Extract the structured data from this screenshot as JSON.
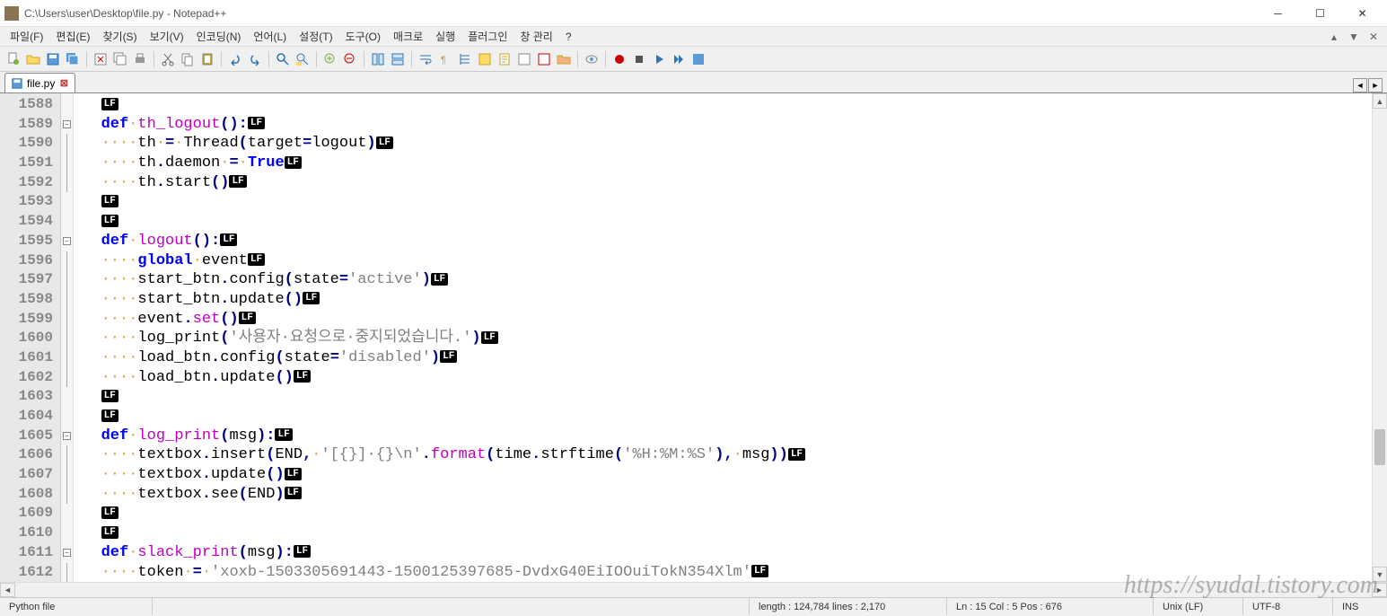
{
  "title": "C:\\Users\\user\\Desktop\\file.py - Notepad++",
  "menu": [
    "파일(F)",
    "편집(E)",
    "찾기(S)",
    "보기(V)",
    "인코딩(N)",
    "언어(L)",
    "설정(T)",
    "도구(O)",
    "매크로",
    "실행",
    "플러그인",
    "창 관리",
    "?"
  ],
  "tab": {
    "name": "file.py"
  },
  "line_start": 1588,
  "line_end": 1612,
  "code": [
    {
      "fold": "",
      "tokens": [
        {
          "t": "lf"
        }
      ]
    },
    {
      "fold": "box",
      "tokens": [
        {
          "t": "kw",
          "v": "def"
        },
        {
          "t": "ws",
          "v": "·"
        },
        {
          "t": "fn",
          "v": "th_logout"
        },
        {
          "t": "op",
          "v": "():"
        },
        {
          "t": "lf"
        }
      ]
    },
    {
      "fold": "line",
      "tokens": [
        {
          "t": "ws",
          "v": "····"
        },
        {
          "t": "txt",
          "v": "th"
        },
        {
          "t": "ws",
          "v": "·"
        },
        {
          "t": "op",
          "v": "="
        },
        {
          "t": "ws",
          "v": "·"
        },
        {
          "t": "txt",
          "v": "Thread"
        },
        {
          "t": "op",
          "v": "("
        },
        {
          "t": "txt",
          "v": "target"
        },
        {
          "t": "op",
          "v": "="
        },
        {
          "t": "txt",
          "v": "logout"
        },
        {
          "t": "op",
          "v": ")"
        },
        {
          "t": "lf"
        }
      ]
    },
    {
      "fold": "line",
      "tokens": [
        {
          "t": "ws",
          "v": "····"
        },
        {
          "t": "txt",
          "v": "th"
        },
        {
          "t": "op",
          "v": "."
        },
        {
          "t": "txt",
          "v": "daemon"
        },
        {
          "t": "ws",
          "v": "·"
        },
        {
          "t": "op",
          "v": "="
        },
        {
          "t": "ws",
          "v": "·"
        },
        {
          "t": "bool",
          "v": "True"
        },
        {
          "t": "lf"
        }
      ]
    },
    {
      "fold": "line",
      "tokens": [
        {
          "t": "ws",
          "v": "····"
        },
        {
          "t": "txt",
          "v": "th"
        },
        {
          "t": "op",
          "v": "."
        },
        {
          "t": "txt",
          "v": "start"
        },
        {
          "t": "op",
          "v": "()"
        },
        {
          "t": "lf"
        }
      ]
    },
    {
      "fold": "",
      "tokens": [
        {
          "t": "lf"
        }
      ]
    },
    {
      "fold": "",
      "tokens": [
        {
          "t": "lf"
        }
      ]
    },
    {
      "fold": "box",
      "tokens": [
        {
          "t": "kw",
          "v": "def"
        },
        {
          "t": "ws",
          "v": "·"
        },
        {
          "t": "fn",
          "v": "logout"
        },
        {
          "t": "op",
          "v": "():"
        },
        {
          "t": "lf"
        }
      ]
    },
    {
      "fold": "line",
      "tokens": [
        {
          "t": "ws",
          "v": "····"
        },
        {
          "t": "kw",
          "v": "global"
        },
        {
          "t": "ws",
          "v": "·"
        },
        {
          "t": "txt",
          "v": "event"
        },
        {
          "t": "lf"
        }
      ]
    },
    {
      "fold": "line",
      "tokens": [
        {
          "t": "ws",
          "v": "····"
        },
        {
          "t": "txt",
          "v": "start_btn"
        },
        {
          "t": "op",
          "v": "."
        },
        {
          "t": "txt",
          "v": "config"
        },
        {
          "t": "op",
          "v": "("
        },
        {
          "t": "txt",
          "v": "state"
        },
        {
          "t": "op",
          "v": "="
        },
        {
          "t": "str",
          "v": "'active'"
        },
        {
          "t": "op",
          "v": ")"
        },
        {
          "t": "lf"
        }
      ]
    },
    {
      "fold": "line",
      "tokens": [
        {
          "t": "ws",
          "v": "····"
        },
        {
          "t": "txt",
          "v": "start_btn"
        },
        {
          "t": "op",
          "v": "."
        },
        {
          "t": "txt",
          "v": "update"
        },
        {
          "t": "op",
          "v": "()"
        },
        {
          "t": "lf"
        }
      ]
    },
    {
      "fold": "line",
      "tokens": [
        {
          "t": "ws",
          "v": "····"
        },
        {
          "t": "txt",
          "v": "event"
        },
        {
          "t": "op",
          "v": "."
        },
        {
          "t": "fn",
          "v": "set"
        },
        {
          "t": "op",
          "v": "()"
        },
        {
          "t": "lf"
        }
      ]
    },
    {
      "fold": "line",
      "tokens": [
        {
          "t": "ws",
          "v": "····"
        },
        {
          "t": "txt",
          "v": "log_print"
        },
        {
          "t": "op",
          "v": "("
        },
        {
          "t": "str",
          "v": "'사용자·요청으로·중지되었습니다.'"
        },
        {
          "t": "op",
          "v": ")"
        },
        {
          "t": "lf"
        }
      ]
    },
    {
      "fold": "line",
      "tokens": [
        {
          "t": "ws",
          "v": "····"
        },
        {
          "t": "txt",
          "v": "load_btn"
        },
        {
          "t": "op",
          "v": "."
        },
        {
          "t": "txt",
          "v": "config"
        },
        {
          "t": "op",
          "v": "("
        },
        {
          "t": "txt",
          "v": "state"
        },
        {
          "t": "op",
          "v": "="
        },
        {
          "t": "str",
          "v": "'disabled'"
        },
        {
          "t": "op",
          "v": ")"
        },
        {
          "t": "lf"
        }
      ]
    },
    {
      "fold": "line",
      "tokens": [
        {
          "t": "ws",
          "v": "····"
        },
        {
          "t": "txt",
          "v": "load_btn"
        },
        {
          "t": "op",
          "v": "."
        },
        {
          "t": "txt",
          "v": "update"
        },
        {
          "t": "op",
          "v": "()"
        },
        {
          "t": "lf"
        }
      ]
    },
    {
      "fold": "",
      "tokens": [
        {
          "t": "lf"
        }
      ]
    },
    {
      "fold": "",
      "tokens": [
        {
          "t": "lf"
        }
      ]
    },
    {
      "fold": "box",
      "tokens": [
        {
          "t": "kw",
          "v": "def"
        },
        {
          "t": "ws",
          "v": "·"
        },
        {
          "t": "fn",
          "v": "log_print"
        },
        {
          "t": "op",
          "v": "("
        },
        {
          "t": "txt",
          "v": "msg"
        },
        {
          "t": "op",
          "v": "):"
        },
        {
          "t": "lf"
        }
      ]
    },
    {
      "fold": "line",
      "tokens": [
        {
          "t": "ws",
          "v": "····"
        },
        {
          "t": "txt",
          "v": "textbox"
        },
        {
          "t": "op",
          "v": "."
        },
        {
          "t": "txt",
          "v": "insert"
        },
        {
          "t": "op",
          "v": "("
        },
        {
          "t": "txt",
          "v": "END"
        },
        {
          "t": "op",
          "v": ","
        },
        {
          "t": "ws",
          "v": "·"
        },
        {
          "t": "str",
          "v": "'[{}]·{}\\n'"
        },
        {
          "t": "op",
          "v": "."
        },
        {
          "t": "fn",
          "v": "format"
        },
        {
          "t": "op",
          "v": "("
        },
        {
          "t": "txt",
          "v": "time"
        },
        {
          "t": "op",
          "v": "."
        },
        {
          "t": "txt",
          "v": "strftime"
        },
        {
          "t": "op",
          "v": "("
        },
        {
          "t": "str",
          "v": "'%H:%M:%S'"
        },
        {
          "t": "op",
          "v": "),"
        },
        {
          "t": "ws",
          "v": "·"
        },
        {
          "t": "txt",
          "v": "msg"
        },
        {
          "t": "op",
          "v": "))"
        },
        {
          "t": "lf"
        }
      ]
    },
    {
      "fold": "line",
      "tokens": [
        {
          "t": "ws",
          "v": "····"
        },
        {
          "t": "txt",
          "v": "textbox"
        },
        {
          "t": "op",
          "v": "."
        },
        {
          "t": "txt",
          "v": "update"
        },
        {
          "t": "op",
          "v": "()"
        },
        {
          "t": "lf"
        }
      ]
    },
    {
      "fold": "line",
      "tokens": [
        {
          "t": "ws",
          "v": "····"
        },
        {
          "t": "txt",
          "v": "textbox"
        },
        {
          "t": "op",
          "v": "."
        },
        {
          "t": "txt",
          "v": "see"
        },
        {
          "t": "op",
          "v": "("
        },
        {
          "t": "txt",
          "v": "END"
        },
        {
          "t": "op",
          "v": ")"
        },
        {
          "t": "lf"
        }
      ]
    },
    {
      "fold": "",
      "tokens": [
        {
          "t": "lf"
        }
      ]
    },
    {
      "fold": "",
      "tokens": [
        {
          "t": "lf"
        }
      ]
    },
    {
      "fold": "box",
      "tokens": [
        {
          "t": "kw",
          "v": "def"
        },
        {
          "t": "ws",
          "v": "·"
        },
        {
          "t": "fn",
          "v": "slack_print"
        },
        {
          "t": "op",
          "v": "("
        },
        {
          "t": "txt",
          "v": "msg"
        },
        {
          "t": "op",
          "v": "):"
        },
        {
          "t": "lf"
        }
      ]
    },
    {
      "fold": "line",
      "tokens": [
        {
          "t": "ws",
          "v": "····"
        },
        {
          "t": "txt",
          "v": "token"
        },
        {
          "t": "ws",
          "v": "·"
        },
        {
          "t": "op",
          "v": "="
        },
        {
          "t": "ws",
          "v": "·"
        },
        {
          "t": "str",
          "v": "'xoxb-1503305691443-1500125397685-DvdxG40EiIOOuiTokN354Xlm'"
        },
        {
          "t": "lf"
        }
      ]
    }
  ],
  "status": {
    "filetype": "Python file",
    "length": "length : 124,784    lines : 2,170",
    "pos": "Ln : 15    Col : 5    Pos : 676",
    "eol": "Unix (LF)",
    "encoding": "UTF-8",
    "ins": "INS"
  },
  "watermark": "https://syudal.tistory.com"
}
